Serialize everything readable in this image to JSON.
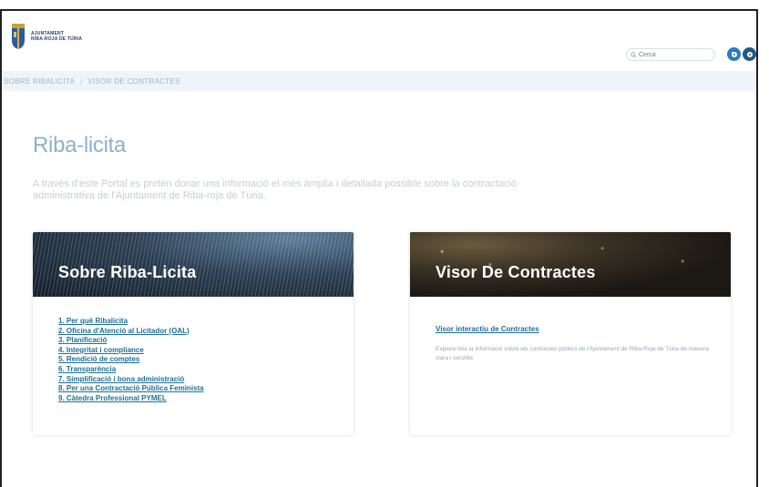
{
  "header": {
    "logo_line1": "AJUNTAMENT",
    "logo_line2": "RIBA-ROJA DE TÚRIA",
    "search_placeholder": "Cerca"
  },
  "nav": {
    "items": [
      "SOBRE RIBALICITA",
      "VISOR DE CONTRACTES"
    ]
  },
  "page": {
    "title": "Riba-licita",
    "intro": "A través d'este Portal es pretén donar una informació el més àmplia i detallada possible sobre la contractació administrativa de l'Ajuntament de Riba-roja de Túria."
  },
  "cards": [
    {
      "title": "Sobre Riba-Licita",
      "links": [
        "1. Per què Ribalicita",
        "2. Oficina d'Atenció al Licitador (OAL)",
        "3. Planificació",
        "4. Integritat i compliance",
        "5. Rendició de comptes",
        "6. Transparència",
        "7. Simplificació i bona administració",
        "8. Per una Contractació Pública Feminista",
        "9. Càtedra Professional PYMEL"
      ]
    },
    {
      "title": "Visor De Contractes",
      "link": "Visor interactiu de Contractes",
      "description": "Explora tota la informació sobre els contractes públics de l'Ajuntament de Riba-Roja de Túria de manera clara i senzilla"
    }
  ],
  "colors": {
    "accent": "#8cb1cf",
    "link": "#1e6f95",
    "nav_bg": "#eef4f9"
  }
}
